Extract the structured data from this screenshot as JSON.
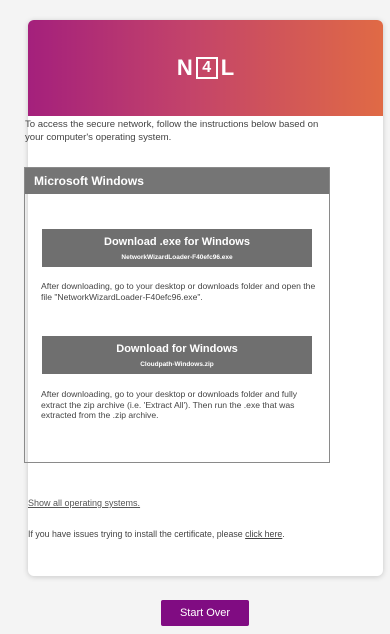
{
  "logo": {
    "n": "N",
    "four": "4",
    "l": "L"
  },
  "intro_text": "To access the secure network, follow the instructions below based on your computer's operating system.",
  "os_section": {
    "title": "Microsoft Windows",
    "download_exe": {
      "label": "Download .exe for Windows",
      "filename": "NetworkWizardLoader-F40efc96.exe"
    },
    "exe_instructions": "After downloading, go to your desktop or downloads folder and open the file \"NetworkWizardLoader-F40efc96.exe\".",
    "download_zip": {
      "label": "Download for Windows",
      "filename": "Cloudpath-Windows.zip"
    },
    "zip_instructions": "After downloading, go to your desktop or downloads folder and fully extract the zip archive (i.e. 'Extract All'). Then run the .exe that was extracted from the .zip archive."
  },
  "show_all_link": "Show all operating systems.",
  "issues": {
    "text": "If you have issues trying to install the certificate, please",
    "link": "click here",
    "suffix": "."
  },
  "start_over_label": "Start Over",
  "colors": {
    "brand_gradient_start": "#a4207c",
    "brand_gradient_end": "#e06a45",
    "button_gray": "#6f6f6f",
    "start_over": "#800c82"
  }
}
